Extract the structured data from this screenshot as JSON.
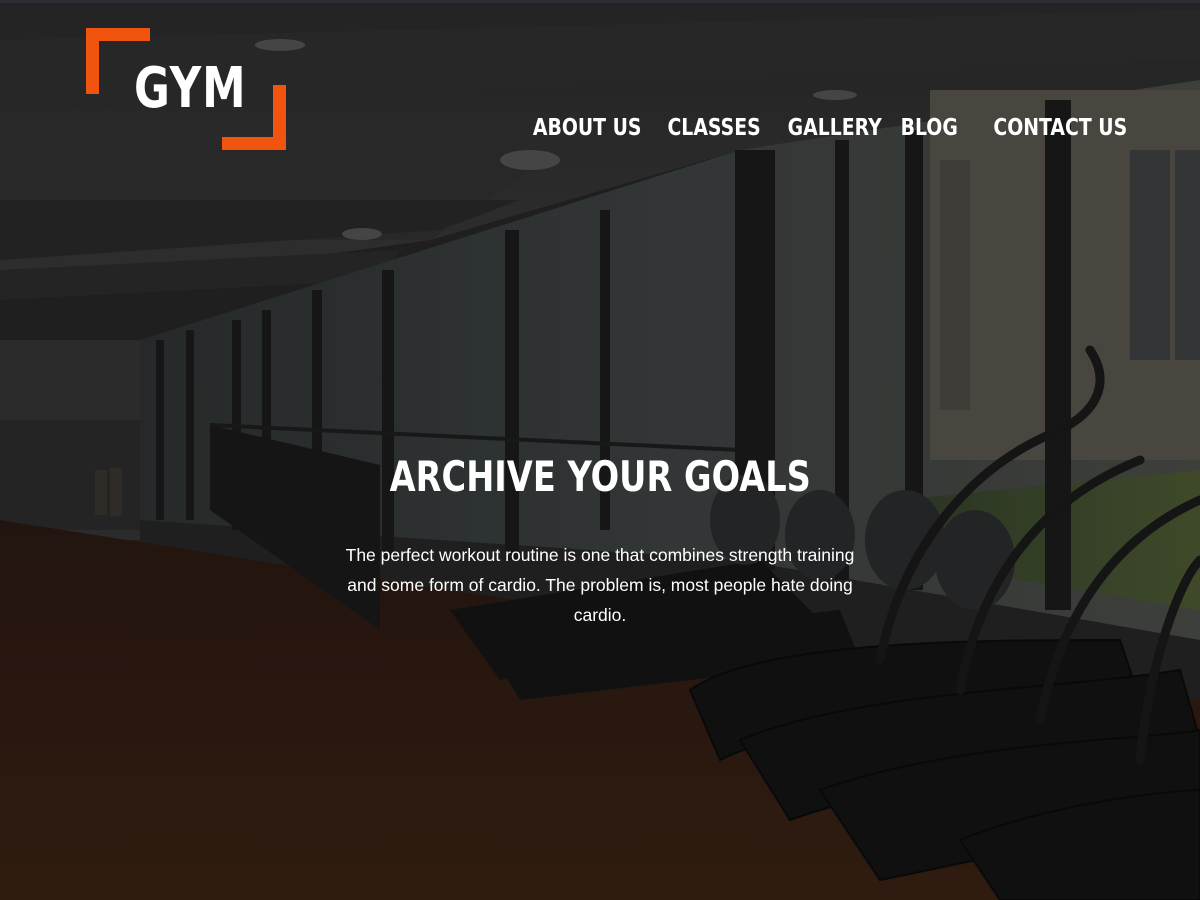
{
  "brand": {
    "logo_text": "GYM",
    "accent_color": "#f0540e"
  },
  "nav": {
    "items": [
      {
        "label": "ABOUT US"
      },
      {
        "label": "CLASSES"
      },
      {
        "label": "GALLERY"
      },
      {
        "label": "BLOG"
      },
      {
        "label": "CONTACT US"
      }
    ]
  },
  "hero": {
    "title": "ARCHIVE YOUR GOALS",
    "text": "The perfect workout routine is one that combines strength training and some form of cardio. The problem is, most people hate doing cardio.",
    "background_description_icon": "gym-interior-photo"
  }
}
